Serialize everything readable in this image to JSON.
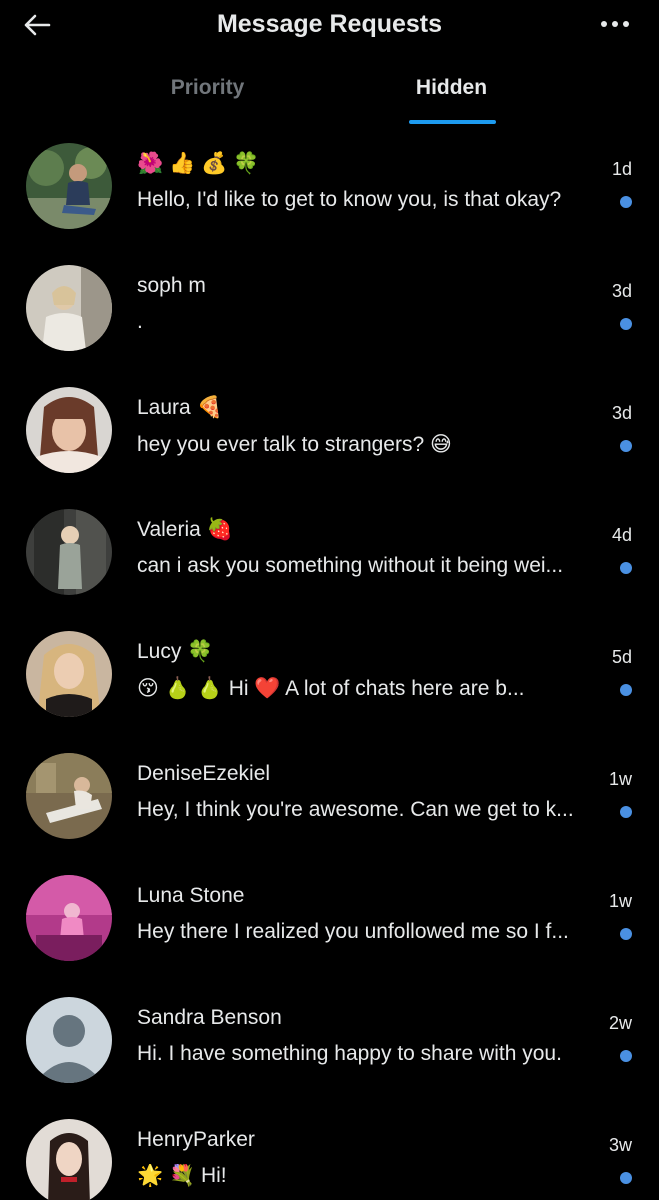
{
  "header": {
    "title": "Message Requests",
    "back_icon": "arrow-left-icon",
    "more_icon": "more-horizontal-icon"
  },
  "tabs": [
    {
      "label": "Priority",
      "active": false
    },
    {
      "label": "Hidden",
      "active": true
    }
  ],
  "colors": {
    "background": "#000000",
    "text": "#e7e9ea",
    "muted": "#71767b",
    "accent": "#1d9bf0",
    "unread_dot": "#4a90e2"
  },
  "conversations": [
    {
      "name": "🌺 👍 💰 🍀",
      "preview": "Hello, I'd like to get to know you, is that okay?",
      "time": "1d",
      "unread": true
    },
    {
      "name": "soph m",
      "preview": ".",
      "time": "3d",
      "unread": true
    },
    {
      "name": "Laura 🍕",
      "preview": "hey you ever talk to strangers? 😅",
      "time": "3d",
      "unread": true
    },
    {
      "name": "Valeria 🍓",
      "preview": "can i ask you something without it being wei...",
      "time": "4d",
      "unread": true
    },
    {
      "name": "Lucy 🍀",
      "preview": "😚 🍐 🍐 Hi      ❤️ A lot of chats here are b...",
      "time": "5d",
      "unread": true
    },
    {
      "name": "DeniseEzekiel",
      "preview": "Hey, I think you're awesome. Can we get to k...",
      "time": "1w",
      "unread": true
    },
    {
      "name": "Luna Stone",
      "preview": "Hey there I realized you unfollowed me so I f...",
      "time": "1w",
      "unread": true
    },
    {
      "name": "Sandra Benson",
      "preview": "Hi. I have something happy to share with you.",
      "time": "2w",
      "unread": true
    },
    {
      "name": "HenryParker",
      "preview": "🌟 💐 Hi!",
      "time": "3w",
      "unread": true
    }
  ]
}
